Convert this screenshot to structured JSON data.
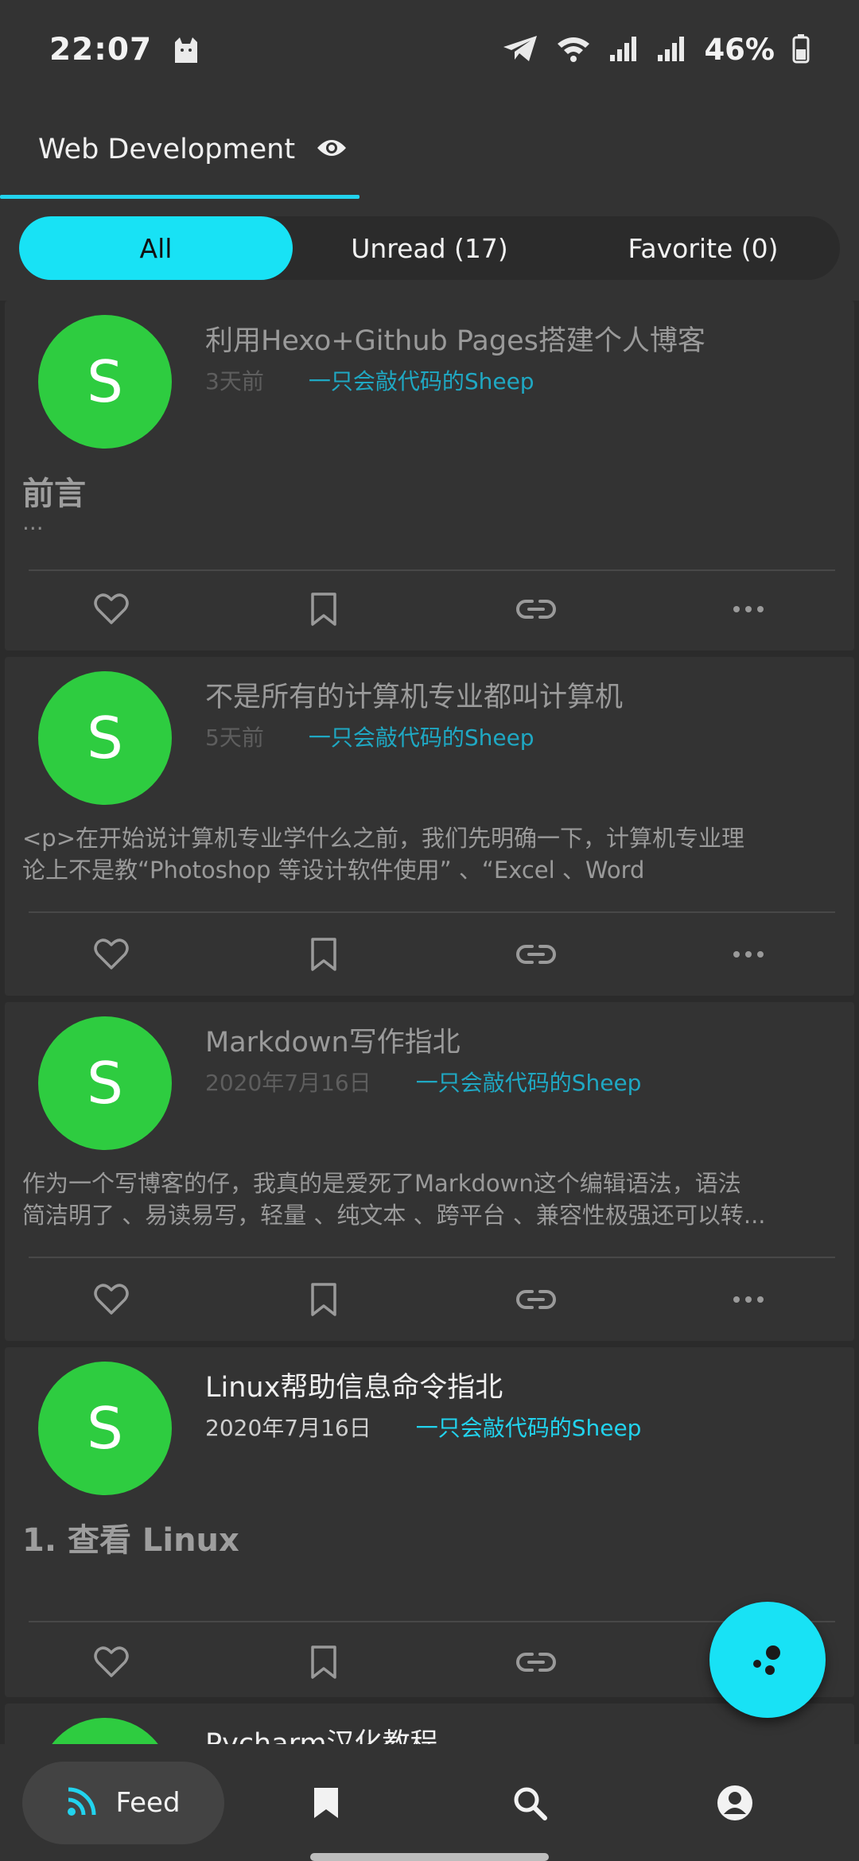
{
  "status_bar": {
    "time": "22:07",
    "battery_percent": "46%",
    "icons": [
      "cat-notification-icon",
      "telegram-icon",
      "wifi-icon",
      "signal-icon",
      "signal-icon",
      "battery-icon"
    ]
  },
  "top_tab": {
    "label": "Web Development",
    "icon": "eye-icon"
  },
  "filters": {
    "all": "All",
    "unread": "Unread (17)",
    "favorite": "Favorite (0)",
    "selected": "All"
  },
  "feed": [
    {
      "avatar_letter": "S",
      "title": "利用Hexo+Github Pages搭建个人博客",
      "time": "3天前",
      "author": "一只会敲代码的Sheep",
      "heading": "前言",
      "excerpt": "...",
      "read": true
    },
    {
      "avatar_letter": "S",
      "title": "不是所有的计算机专业都叫计算机",
      "time": "5天前",
      "author": "一只会敲代码的Sheep",
      "excerpt_line1": "<p>在开始说计算机专业学什么之前，我们先明确一下，计算机专业理",
      "excerpt_line2": "论上不是教“Photoshop 等设计软件使用” 、“Excel 、Word",
      "read": true
    },
    {
      "avatar_letter": "S",
      "title": "Markdown写作指北",
      "time": "2020年7月16日",
      "author": "一只会敲代码的Sheep",
      "excerpt_line1": "作为一个写博客的仔，我真的是爱死了Markdown这个编辑语法，语法",
      "excerpt_line2": "简洁明了 、易读易写，轻量 、纯文本 、跨平台 、兼容性极强还可以转...",
      "read": true
    },
    {
      "avatar_letter": "S",
      "title": "Linux帮助信息命令指北",
      "time": "2020年7月16日",
      "author": "一只会敲代码的Sheep",
      "heading": "1. 查看 Linux",
      "read": false
    },
    {
      "avatar_letter": "S",
      "title": "Pycharm汉化教程",
      "read": false
    }
  ],
  "card_actions": [
    "heart-icon",
    "bookmark-icon",
    "link-icon",
    "more-icon"
  ],
  "fab": {
    "icon": "scatter-dots-icon"
  },
  "bottom_nav": {
    "feed_label": "Feed",
    "items": [
      "rss-icon",
      "bookmark-icon",
      "search-icon",
      "account-icon"
    ],
    "selected": "Feed"
  },
  "colors": {
    "accent": "#18e2f5",
    "avatar": "#2ecc40",
    "background": "#2b2b2b",
    "surface": "#333333",
    "author_link": "#22d3ee"
  }
}
